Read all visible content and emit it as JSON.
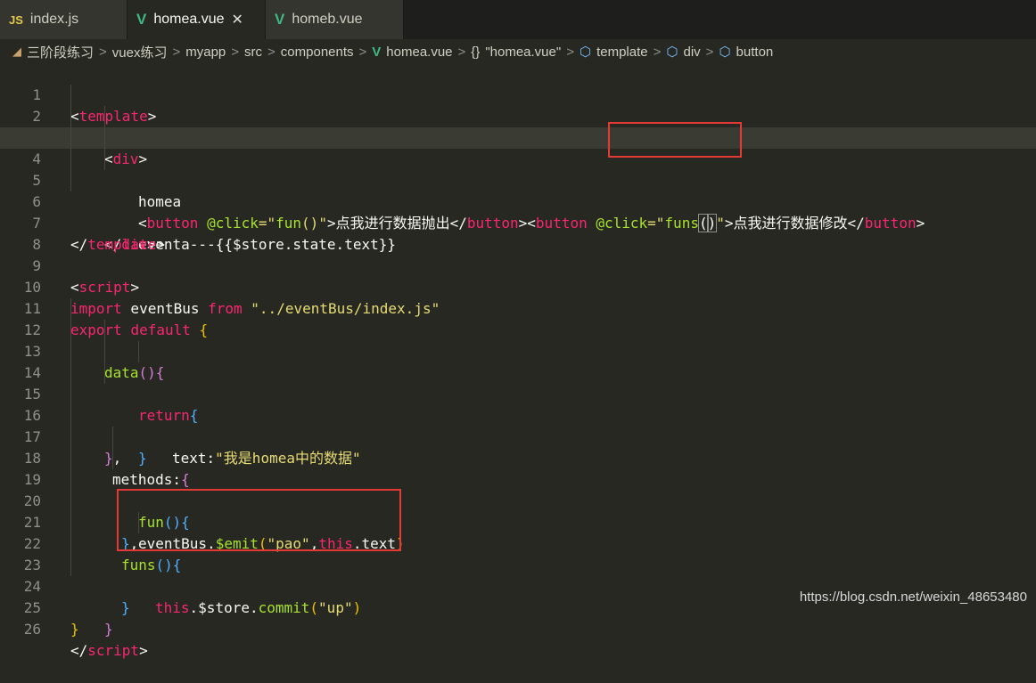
{
  "tabs": [
    {
      "icon": "js-icon",
      "badge": "JS",
      "label": "index.js",
      "active": false,
      "closable": false
    },
    {
      "icon": "vue-icon",
      "badge": "V",
      "label": "homea.vue",
      "active": true,
      "closable": true
    },
    {
      "icon": "vue-icon",
      "badge": "V",
      "label": "homeb.vue",
      "active": false,
      "closable": false
    }
  ],
  "close_glyph": "✕",
  "breadcrumb": [
    "三阶段练习",
    "vuex练习",
    "myapp",
    "src",
    "components",
    "homea.vue",
    "\"homea.vue\"",
    "template",
    "div",
    "button"
  ],
  "breadcrumb_sep": ">",
  "breadcrumb_braces": "{}",
  "watermark": "https://blog.csdn.net/weixin_48653480",
  "current_line": 4,
  "highlight_color": "#e53935",
  "code": {
    "l1": [
      "<",
      "template",
      ">"
    ],
    "l2": [
      "<",
      "div",
      ">"
    ],
    "l3": [
      "homea"
    ],
    "l4": [
      "<",
      "button",
      "@click",
      "=\"",
      "fun",
      "()",
      "\"",
      ">点我进行数据抛出</",
      "button",
      "><",
      "button",
      "@click",
      "=\"",
      "funs",
      "(",
      ")",
      "\"",
      ">点我进行数据修改</",
      "button",
      ">"
    ],
    "l5": [
      "eventa---{{$store.state.text}}"
    ],
    "l6": [
      "</",
      "div",
      ">"
    ],
    "l7": [
      "</",
      "template",
      ">"
    ],
    "l9": [
      "<",
      "script",
      ">"
    ],
    "l10": [
      "import",
      " eventBus ",
      "from",
      " \"../eventBus/index.js\""
    ],
    "l11": [
      "export",
      " ",
      "default",
      " ",
      "{"
    ],
    "l12": [
      "data",
      "()",
      "{"
    ],
    "l13": [
      "return",
      "{"
    ],
    "l14": [
      "text:",
      "\"我是homea中的数据\""
    ],
    "l15": [
      "}"
    ],
    "l16": [
      "}",
      ","
    ],
    "l17": [
      "methods:",
      "{"
    ],
    "l18": [
      "fun",
      "()",
      "{"
    ],
    "l19": [
      "eventBus.",
      "$emit",
      "(",
      "\"pao\"",
      ",",
      "this",
      ".text",
      ")"
    ],
    "l20": [
      "}",
      ","
    ],
    "l21": [
      "funs",
      "()",
      "{"
    ],
    "l22": [
      "this",
      ".",
      "$store",
      ".",
      "commit",
      "(",
      "\"up\"",
      ")"
    ],
    "l23": [
      "}"
    ],
    "l24": [
      "}"
    ],
    "l25": [
      "}"
    ],
    "l26": [
      "</",
      "script",
      ">"
    ]
  }
}
